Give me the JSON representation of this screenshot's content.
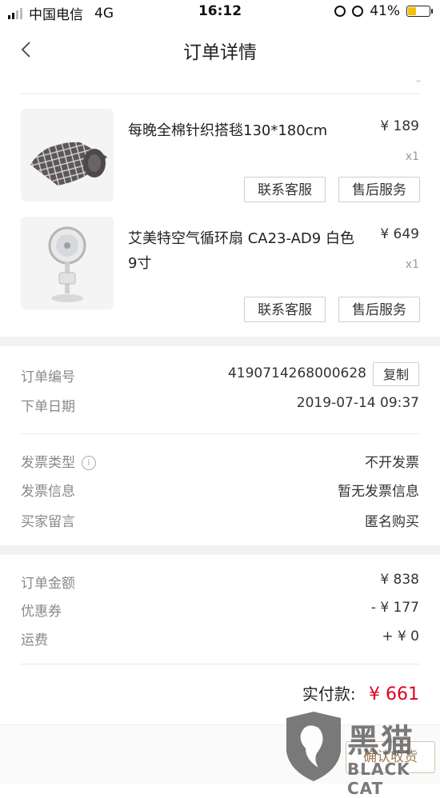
{
  "status_bar": {
    "carrier": "中国电信",
    "network": "4G",
    "time": "16:12",
    "battery_percent": "41%",
    "battery_level": 0.41
  },
  "nav": {
    "title": "订单详情"
  },
  "products": [
    {
      "name": "每晚全棉针织搭毯130*180cm",
      "price": "¥ 189",
      "qty": "x1",
      "contact_label": "联系客服",
      "after_sales_label": "售后服务",
      "thumb_icon": "blanket-image"
    },
    {
      "name": "艾美特空气循环扇 CA23-AD9 白色9寸",
      "price": "¥ 649",
      "qty": "x1",
      "contact_label": "联系客服",
      "after_sales_label": "售后服务",
      "thumb_icon": "fan-image"
    }
  ],
  "order_info": {
    "order_no_label": "订单编号",
    "order_no": "4190714268000628",
    "copy_label": "复制",
    "date_label": "下单日期",
    "date": "2019-07-14 09:37"
  },
  "invoice": {
    "type_label": "发票类型",
    "type_value": "不开发票",
    "info_label": "发票信息",
    "info_value": "暂无发票信息",
    "message_label": "买家留言",
    "message_value": "匿名购买"
  },
  "amounts": {
    "total_label": "订单金额",
    "total_value": "¥ 838",
    "coupon_label": "优惠券",
    "coupon_value": "- ¥ 177",
    "shipping_label": "运费",
    "shipping_value": "+ ¥ 0",
    "paid_label": "实付款:",
    "paid_value": "¥ 661"
  },
  "footer": {
    "confirm_label": "确认收货"
  },
  "watermark": {
    "text": "黑猫",
    "sub": "BLACK CAT"
  },
  "colors": {
    "price_red": "#e0001b",
    "battery_yellow": "#f2c200"
  }
}
